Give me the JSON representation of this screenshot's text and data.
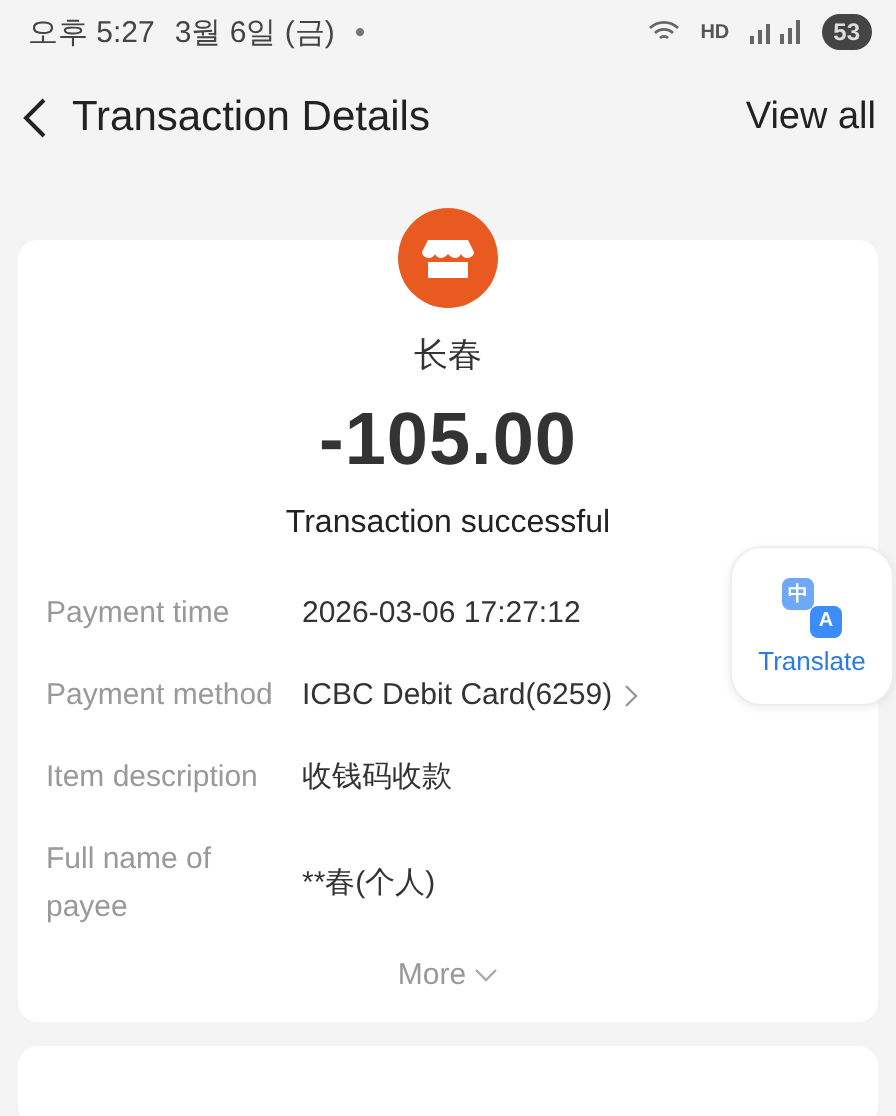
{
  "status_bar": {
    "time": "오후 5:27",
    "date": "3월 6일 (금)",
    "notification_dot": "•",
    "network": "HD",
    "battery": "53"
  },
  "header": {
    "title": "Transaction Details",
    "action": "View all"
  },
  "transaction": {
    "merchant": "长春",
    "amount": "-105.00",
    "status": "Transaction successful",
    "details": [
      {
        "label": "Payment time",
        "value": "2026-03-06 17:27:12",
        "link": false
      },
      {
        "label": "Payment method",
        "value": "ICBC Debit Card(6259)",
        "link": true
      },
      {
        "label": "Item description",
        "value": "收钱码收款",
        "link": false
      },
      {
        "label": "Full name of payee",
        "value": "**春(个人)",
        "link": false
      }
    ],
    "more": "More"
  },
  "translate_button": {
    "label": "Translate",
    "icon_source": "中",
    "icon_target": "A"
  }
}
